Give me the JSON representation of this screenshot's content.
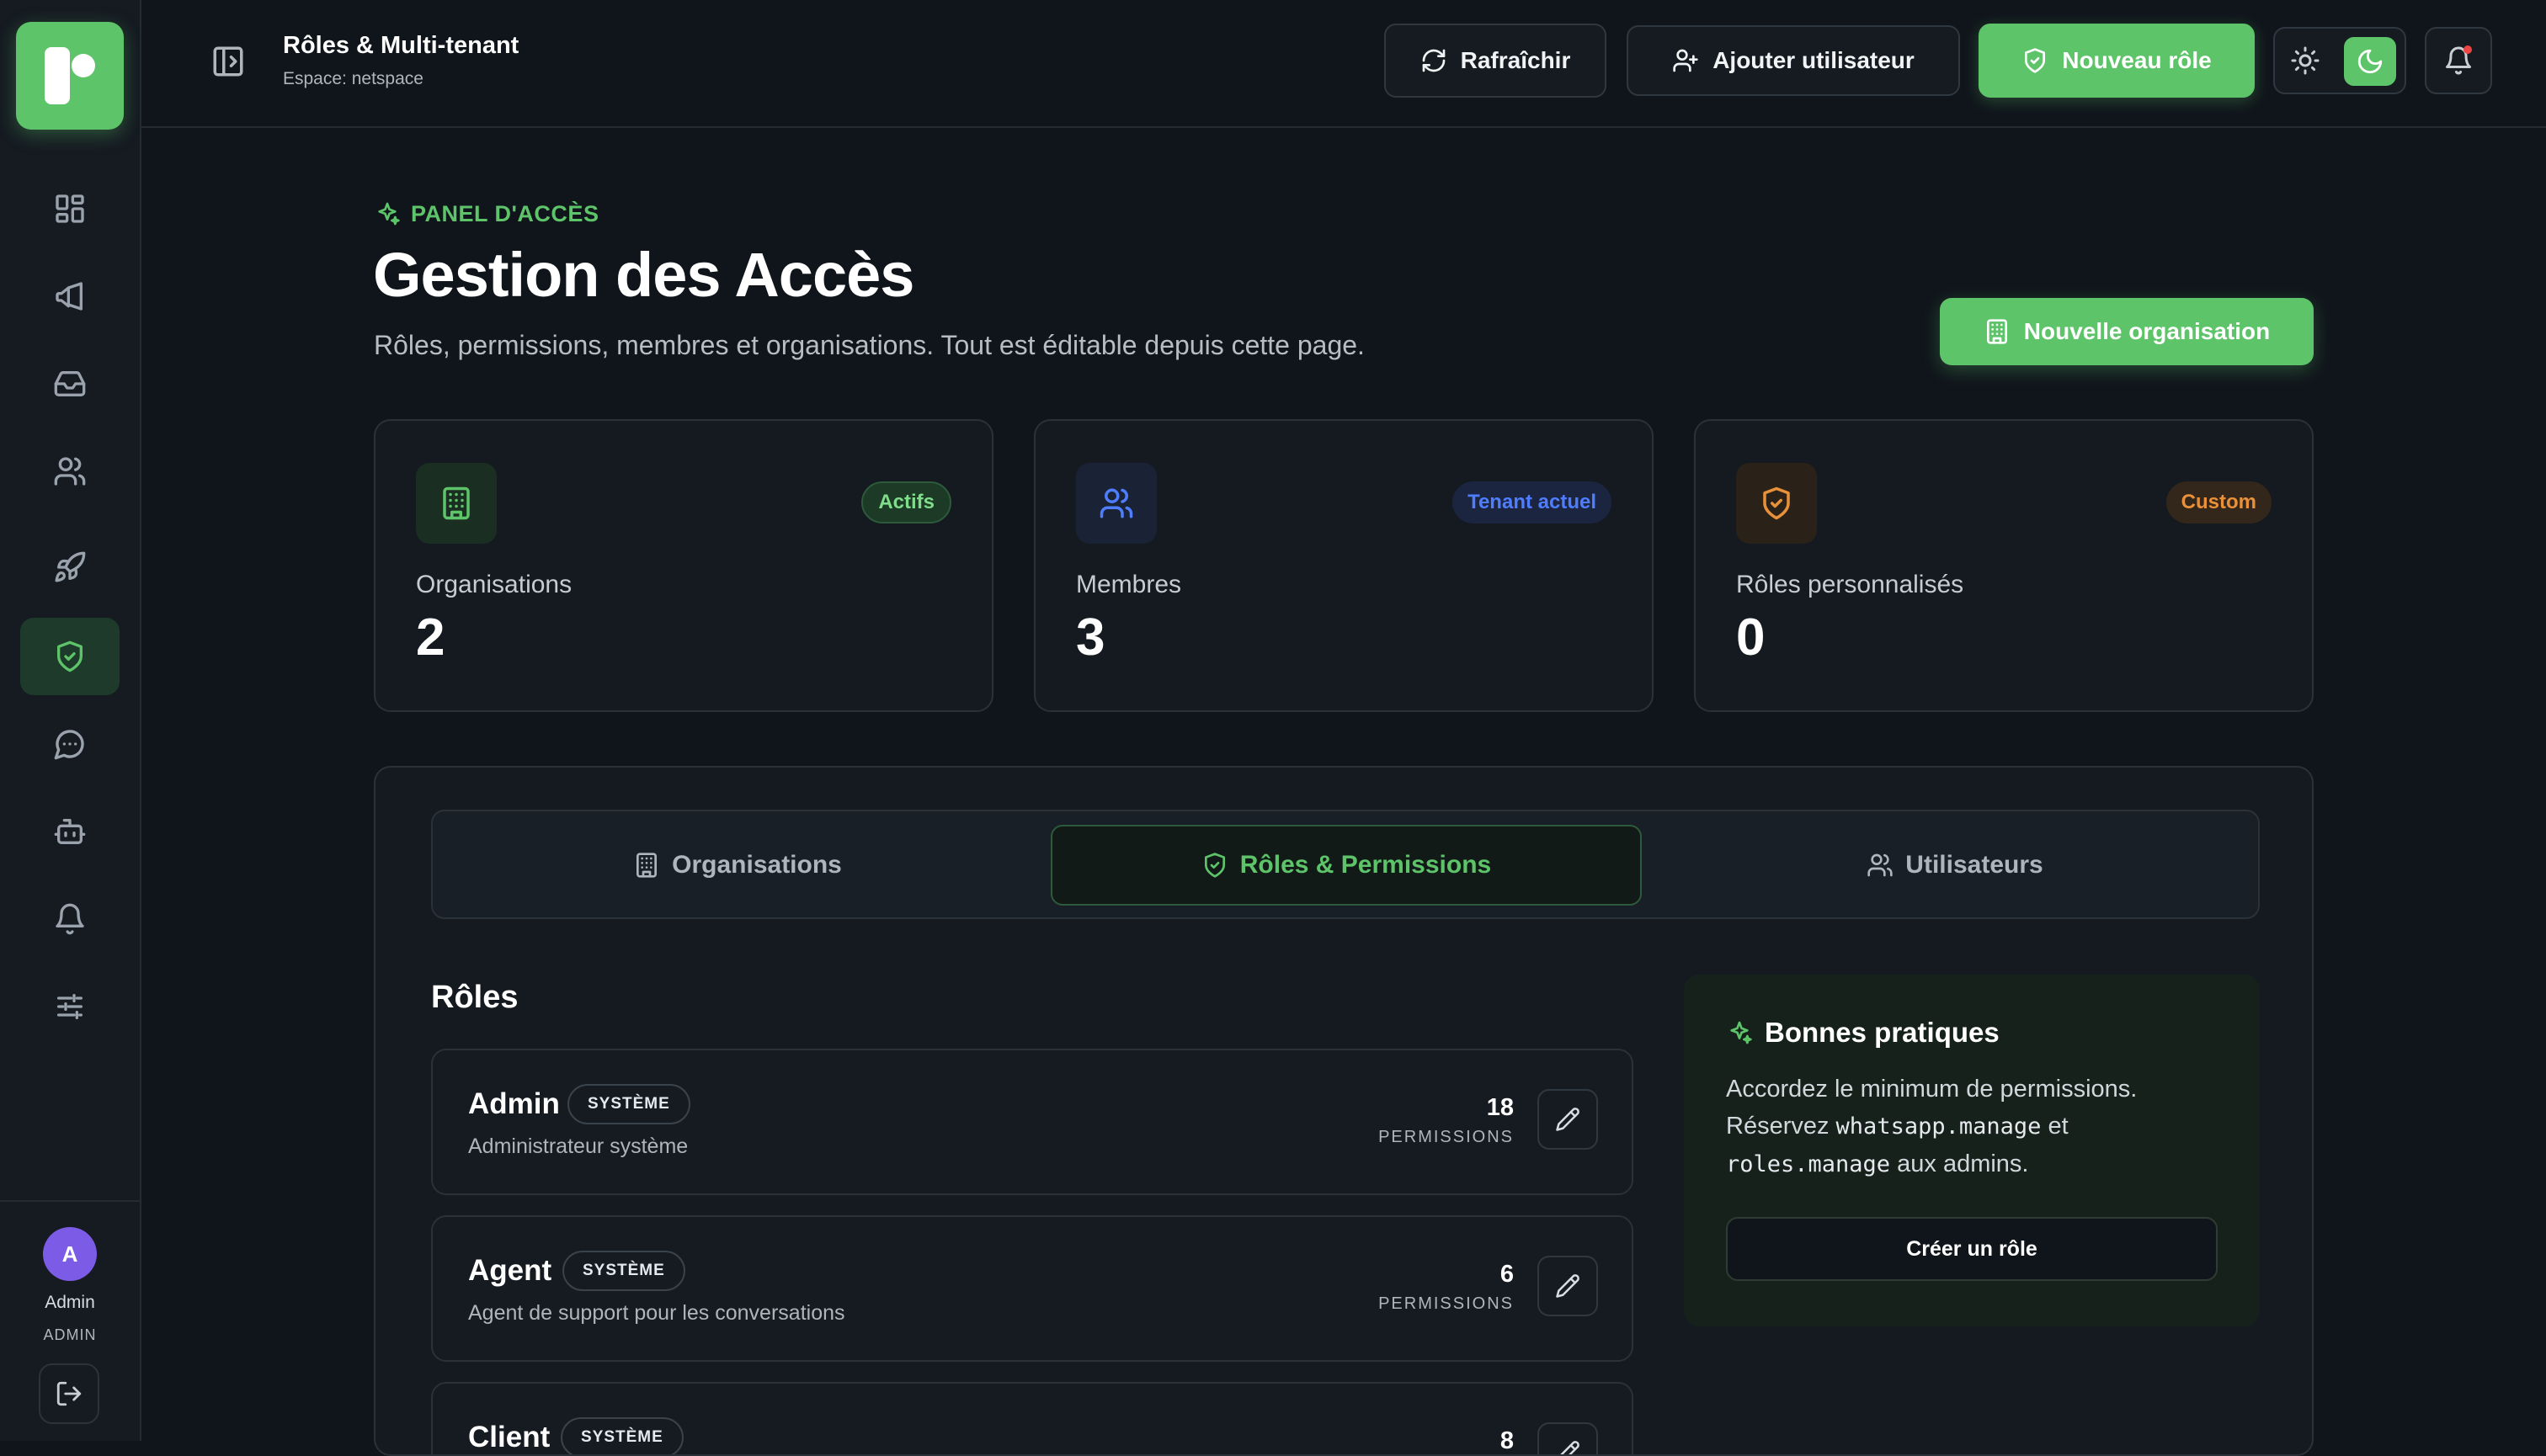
{
  "header": {
    "title": "Rôles & Multi-tenant",
    "subtitle": "Espace: netspace",
    "refresh_label": "Rafraîchir",
    "add_user_label": "Ajouter utilisateur",
    "new_role_label": "Nouveau rôle"
  },
  "sidebar": {
    "items": [
      {
        "icon": "dashboard-icon"
      },
      {
        "icon": "megaphone-icon"
      },
      {
        "icon": "inbox-icon"
      },
      {
        "icon": "users-icon"
      },
      {
        "icon": "rocket-icon"
      },
      {
        "icon": "shield-check-icon",
        "active": true
      },
      {
        "icon": "chat-icon"
      },
      {
        "icon": "bot-icon"
      },
      {
        "icon": "bell-icon"
      },
      {
        "icon": "sliders-icon"
      }
    ],
    "user": {
      "initial": "A",
      "name": "Admin",
      "role": "ADMIN"
    }
  },
  "page": {
    "eyebrow": "PANEL D'ACCÈS",
    "title": "Gestion des Accès",
    "description": "Rôles, permissions, membres et organisations. Tout est éditable depuis cette page.",
    "new_org_label": "Nouvelle organisation"
  },
  "stats": [
    {
      "label": "Organisations",
      "value": "2",
      "badge": "Actifs",
      "color": "#5ec46a"
    },
    {
      "label": "Membres",
      "value": "3",
      "badge": "Tenant actuel",
      "color": "#4f7dff"
    },
    {
      "label": "Rôles personnalisés",
      "value": "0",
      "badge": "Custom",
      "color": "#e8913a"
    }
  ],
  "tabs": [
    {
      "label": "Organisations"
    },
    {
      "label": "Rôles & Permissions",
      "active": true
    },
    {
      "label": "Utilisateurs"
    }
  ],
  "roles_section": {
    "title": "Rôles",
    "count_label": "PERMISSIONS",
    "roles": [
      {
        "name": "Admin",
        "badge": "SYSTÈME",
        "description": "Administrateur système",
        "permissions": "18"
      },
      {
        "name": "Agent",
        "badge": "SYSTÈME",
        "description": "Agent de support pour les conversations",
        "permissions": "6"
      },
      {
        "name": "Client",
        "badge": "SYSTÈME",
        "description": "",
        "permissions": "8"
      }
    ]
  },
  "tips": {
    "title": "Bonnes pratiques",
    "line1": "Accordez le minimum de permissions.",
    "line2_prefix": "Réservez ",
    "code1": "whatsapp.manage",
    "line2_mid": " et",
    "code2": "roles.manage",
    "line3_suffix": " aux admins.",
    "button_label": "Créer un rôle"
  },
  "colors": {
    "accent": "#5ec46a",
    "background": "#10151b",
    "surface": "#141a20"
  }
}
